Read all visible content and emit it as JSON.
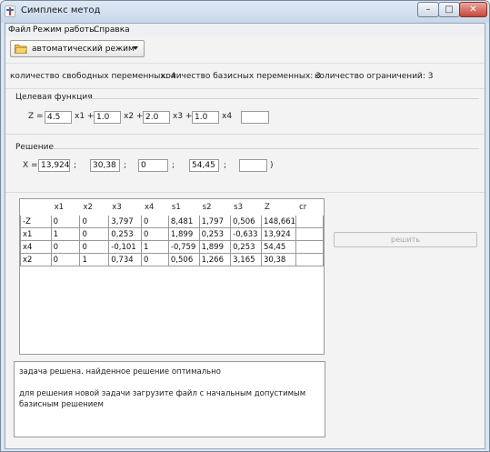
{
  "window": {
    "title": "Симплекс метод",
    "minimize_glyph": "–",
    "maximize_glyph": "□",
    "close_glyph": "✕"
  },
  "menu": {
    "items": [
      "Файл",
      "Режим работы",
      "Справка"
    ]
  },
  "toolbar": {
    "mode_value": "автоматический режим",
    "mode_icon": "folder-icon"
  },
  "counts": {
    "free_vars": "количество свободных переменных: 4",
    "basis_vars": "количество базисных переменных:  3",
    "constraints": "количество ограничений:  3"
  },
  "objective": {
    "label": "Целевая функция",
    "z_prefix": "Z =",
    "coeffs": [
      "4.5",
      "1.0",
      "2.0",
      "1.0",
      ""
    ],
    "terms": [
      "x1 +",
      "x2 +",
      "x3 +",
      "x4"
    ]
  },
  "solution": {
    "label": "Решение",
    "x_prefix": "X =(",
    "values": [
      "13,924",
      "30,38",
      "0",
      "54,45",
      ""
    ],
    "separator": ";",
    "close_paren": ")"
  },
  "table": {
    "headers": [
      "",
      "x1",
      "x2",
      "x3",
      "x4",
      "s1",
      "s2",
      "s3",
      "Z",
      "cr"
    ],
    "rows": [
      [
        "-Z",
        "0",
        "0",
        "3,797",
        "0",
        "8,481",
        "1,797",
        "0,506",
        "148,661",
        ""
      ],
      [
        "x1",
        "1",
        "0",
        "0,253",
        "0",
        "1,899",
        "0,253",
        "-0,633",
        "13,924",
        ""
      ],
      [
        "x4",
        "0",
        "0",
        "-0,101",
        "1",
        "-0,759",
        "1,899",
        "0,253",
        "54,45",
        ""
      ],
      [
        "x2",
        "0",
        "1",
        "0,734",
        "0",
        "0,506",
        "1,266",
        "3,165",
        "30,38",
        ""
      ]
    ]
  },
  "solve_button": {
    "label": "решить"
  },
  "message": {
    "lines": [
      "задача решена. найденное решение оптимально",
      "",
      "для решения новой задачи загрузите файл с начальным допустимым",
      "базисным решением"
    ]
  },
  "colors": {
    "title_bar": "#c7d7ea",
    "panel_bg": "#f3f3f3",
    "close_button": "#c8453a",
    "disabled_text": "#a8a8a8"
  }
}
